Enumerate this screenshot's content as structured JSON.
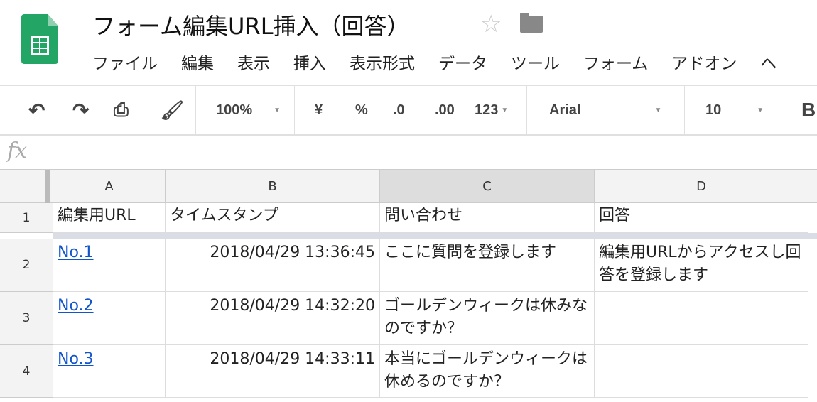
{
  "app": {
    "title": "フォーム編集URL挿入（回答）",
    "star_icon": "star-icon",
    "folder_icon": "folder-icon"
  },
  "menu": [
    "ファイル",
    "編集",
    "表示",
    "挿入",
    "表示形式",
    "データ",
    "ツール",
    "フォーム",
    "アドオン",
    "ヘ"
  ],
  "toolbar": {
    "zoom": "100%",
    "currency": "¥",
    "percent": "%",
    "dec_less": ".0",
    "dec_more": ".00",
    "number_format": "123",
    "font": "Arial",
    "font_size": "10",
    "bold": "B"
  },
  "formula_bar": {
    "label": "fx",
    "value": ""
  },
  "columns": [
    "A",
    "B",
    "C",
    "D"
  ],
  "rows": [
    {
      "num": "1",
      "cells": [
        "編集用URL",
        "タイムスタンプ",
        "問い合わせ",
        "回答"
      ]
    },
    {
      "num": "2",
      "cells": [
        "No.1",
        "2018/04/29 13:36:45",
        "ここに質問を登録します",
        "編集用URLからアクセスし回答を登録します"
      ]
    },
    {
      "num": "3",
      "cells": [
        "No.2",
        "2018/04/29 14:32:20",
        "ゴールデンウィークは休みなのですか？",
        ""
      ]
    },
    {
      "num": "4",
      "cells": [
        "No.3",
        "2018/04/29 14:33:11",
        "本当にゴールデンウィークは休めるのですか？",
        ""
      ]
    }
  ],
  "colors": {
    "link": "#1155cc",
    "brand": "#23a566"
  }
}
